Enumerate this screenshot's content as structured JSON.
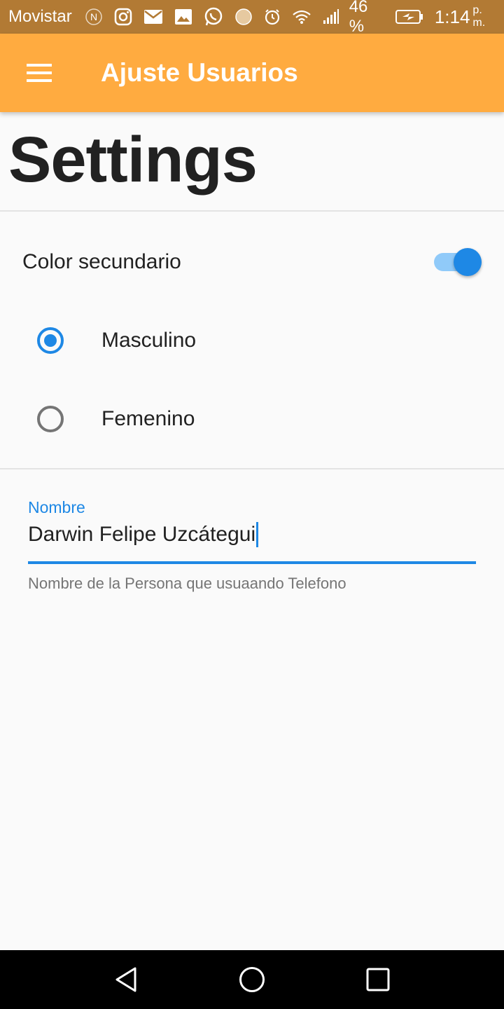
{
  "status_bar": {
    "carrier": "Movistar",
    "battery_percent": "46 %",
    "time": "1:14",
    "ampm": "p. m.",
    "icons": [
      "nfc-icon",
      "instagram-icon",
      "mail-icon",
      "image-icon",
      "whatsapp-icon",
      "app-icon",
      "alarm-icon",
      "wifi-icon",
      "signal-icon",
      "battery-charging-icon"
    ]
  },
  "app_bar": {
    "title": "Ajuste Usuarios",
    "menu_icon": "menu-icon",
    "background": "#ffab40"
  },
  "page": {
    "heading": "Settings"
  },
  "switch": {
    "label": "Color secundario",
    "on": true,
    "accent": "#1e88e5"
  },
  "radio": {
    "options": [
      {
        "label": "Masculino",
        "selected": true
      },
      {
        "label": "Femenino",
        "selected": false
      }
    ]
  },
  "name_field": {
    "label": "Nombre",
    "value": "Darwin Felipe Uzcátegui",
    "helper": "Nombre de la Persona que usuaando Telefono"
  },
  "nav_bar": {
    "buttons": [
      "back-icon",
      "home-icon",
      "recents-icon"
    ]
  }
}
